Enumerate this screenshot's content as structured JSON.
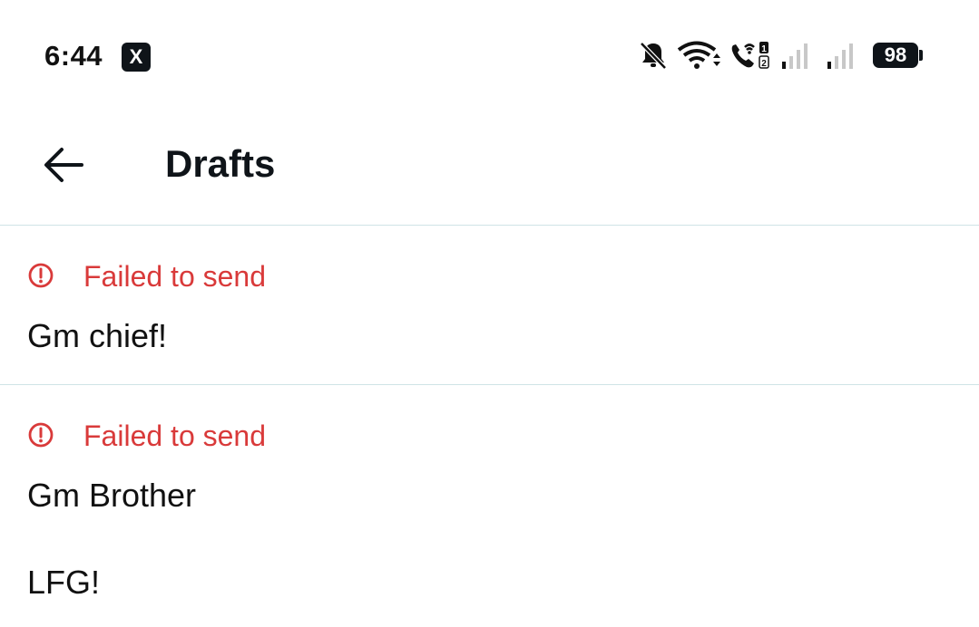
{
  "status_bar": {
    "time": "6:44",
    "app_icon": "X",
    "battery": "98",
    "icons": [
      "bell-muted-icon",
      "wifi-icon",
      "wifi-calling-icon",
      "signal-sim1-icon",
      "signal-sim2-icon",
      "battery-icon"
    ]
  },
  "header": {
    "title": "Drafts",
    "back_icon": "arrow-left-icon"
  },
  "drafts": [
    {
      "error_label": "Failed to send",
      "lines": [
        "Gm chief!"
      ]
    },
    {
      "error_label": "Failed to send",
      "lines": [
        "Gm Brother",
        "LFG!"
      ]
    }
  ],
  "colors": {
    "error": "#d93a3a",
    "divider": "#cfe3e6",
    "text": "#0f1419"
  }
}
